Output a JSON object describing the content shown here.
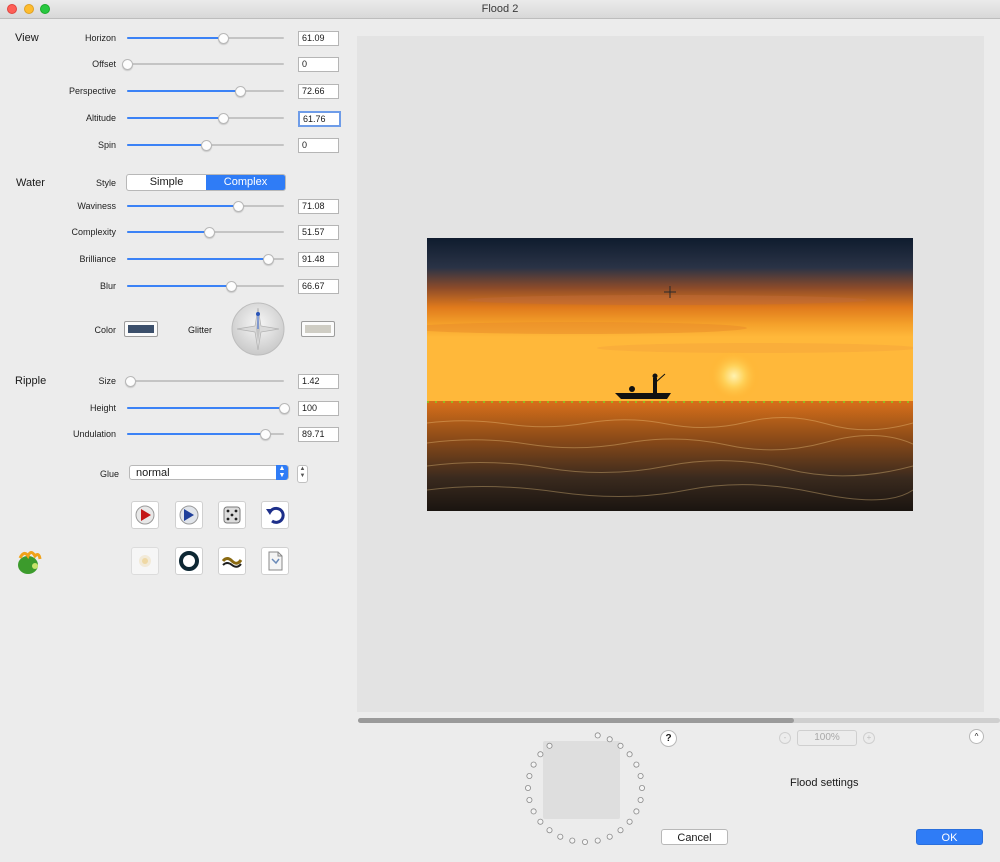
{
  "window": {
    "title": "Flood 2"
  },
  "sections": {
    "view": "View",
    "water": "Water",
    "ripple": "Ripple"
  },
  "sliders": {
    "horizon": {
      "label": "Horizon",
      "value": "61.09",
      "fraction": 0.61
    },
    "offset": {
      "label": "Offset",
      "value": "0",
      "fraction": 0.0
    },
    "perspective": {
      "label": "Perspective",
      "value": "72.66",
      "fraction": 0.72
    },
    "altitude": {
      "label": "Altitude",
      "value": "61.76",
      "fraction": 0.61
    },
    "spin": {
      "label": "Spin",
      "value": "0",
      "fraction": 0.5
    },
    "waviness": {
      "label": "Waviness",
      "value": "71.08",
      "fraction": 0.71
    },
    "complexity": {
      "label": "Complexity",
      "value": "51.57",
      "fraction": 0.52
    },
    "brilliance": {
      "label": "Brilliance",
      "value": "91.48",
      "fraction": 0.9
    },
    "blur": {
      "label": "Blur",
      "value": "66.67",
      "fraction": 0.66
    },
    "size": {
      "label": "Size",
      "value": "1.42",
      "fraction": 0.02
    },
    "height": {
      "label": "Height",
      "value": "100",
      "fraction": 1.0
    },
    "undulation": {
      "label": "Undulation",
      "value": "89.71",
      "fraction": 0.88
    }
  },
  "style": {
    "label": "Style",
    "options": [
      "Simple",
      "Complex"
    ],
    "selected": "Complex"
  },
  "color": {
    "label": "Color",
    "swatch": "#3b4f6b"
  },
  "glitter": {
    "label": "Glitter",
    "swatch": "#cfcdc4"
  },
  "glue": {
    "label": "Glue",
    "value": "normal"
  },
  "tools_row1": [
    "render-preview-icon",
    "play-preview-icon",
    "randomize-dice-icon",
    "reset-undo-icon"
  ],
  "tools_row2": [
    "light-icon",
    "ring-icon",
    "wave-icon",
    "document-icon"
  ],
  "zoom": {
    "value": "100%"
  },
  "help": "?",
  "caret": "^",
  "status": "Flood settings",
  "buttons": {
    "cancel": "Cancel",
    "ok": "OK"
  },
  "colors": {
    "accent": "#2f7cf6",
    "panel": "#ececec",
    "preview_bg": "#e3e3e3"
  }
}
